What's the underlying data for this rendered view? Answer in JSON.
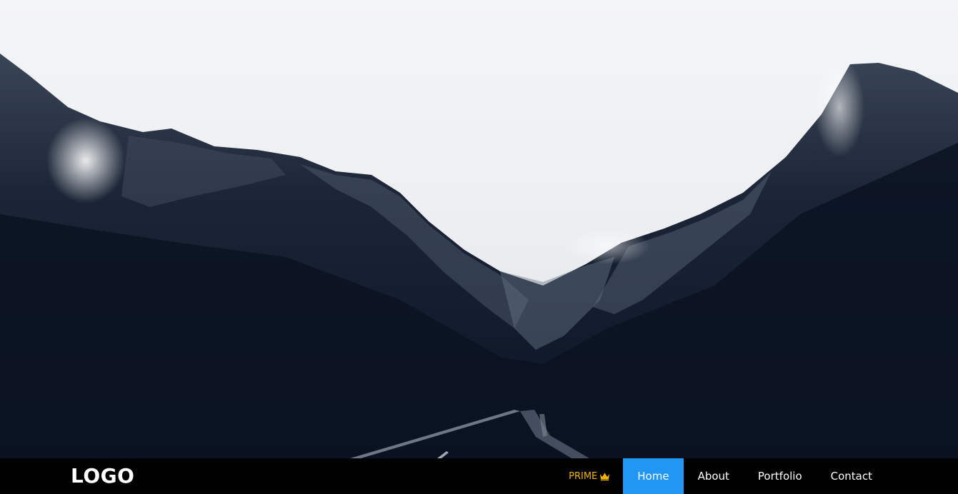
{
  "hero": {
    "image_description": "dark mountain valley with misty white sky and a road",
    "colors": {
      "sky": "#eef0f2",
      "mountain": "#0b1424",
      "rock_highlight": "#5f6a7a"
    }
  },
  "navbar": {
    "logo": "LOGO",
    "prime_label": "PRIME",
    "prime_icon": "crown-icon",
    "items": [
      {
        "label": "Home",
        "active": true
      },
      {
        "label": "About",
        "active": false
      },
      {
        "label": "Portfolio",
        "active": false
      },
      {
        "label": "Contact",
        "active": false
      }
    ],
    "colors": {
      "background": "#000000",
      "active": "#2196f3",
      "prime": "#f2b300",
      "text": "#ffffff"
    }
  }
}
